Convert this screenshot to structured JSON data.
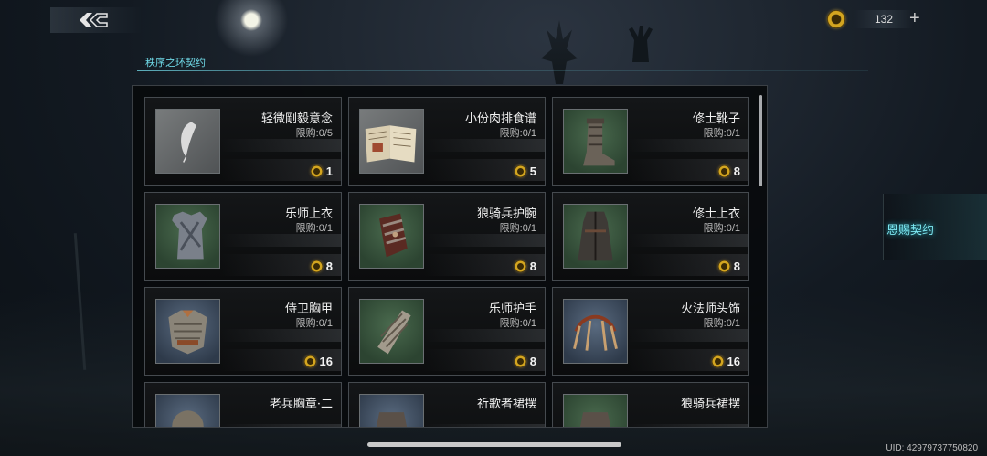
{
  "header": {
    "currency_amount": "132",
    "plus_label": "+"
  },
  "tab": {
    "title": "秩序之环契约"
  },
  "side_tab": {
    "label": "恩赐契约"
  },
  "uid": "UID: 42979737750820",
  "items": [
    {
      "name": "轻微剛毅意念",
      "limit": "限购:0/5",
      "price": "1",
      "icon": "feather-wisp-icon",
      "bg": "gray"
    },
    {
      "name": "小份肉排食谱",
      "limit": "限购:0/1",
      "price": "5",
      "icon": "recipe-book-icon",
      "bg": "gray"
    },
    {
      "name": "修士靴子",
      "limit": "限购:0/1",
      "price": "8",
      "icon": "boots-icon",
      "bg": "green"
    },
    {
      "name": "乐师上衣",
      "limit": "限购:0/1",
      "price": "8",
      "icon": "tunic-icon",
      "bg": "green"
    },
    {
      "name": "狼骑兵护腕",
      "limit": "限购:0/1",
      "price": "8",
      "icon": "bracer-icon",
      "bg": "green"
    },
    {
      "name": "修士上衣",
      "limit": "限购:0/1",
      "price": "8",
      "icon": "robe-icon",
      "bg": "green"
    },
    {
      "name": "侍卫胸甲",
      "limit": "限购:0/1",
      "price": "16",
      "icon": "chest-armor-icon",
      "bg": "blue"
    },
    {
      "name": "乐师护手",
      "limit": "限购:0/1",
      "price": "8",
      "icon": "gauntlet-icon",
      "bg": "green"
    },
    {
      "name": "火法师头饰",
      "limit": "限购:0/1",
      "price": "16",
      "icon": "headdress-icon",
      "bg": "blue"
    },
    {
      "name": "老兵胸章·二",
      "limit": "",
      "price": "",
      "icon": "badge-icon",
      "bg": "blue"
    },
    {
      "name": "祈歌者裙摆",
      "limit": "",
      "price": "",
      "icon": "skirt-icon",
      "bg": "blue"
    },
    {
      "name": "狼骑兵裙摆",
      "limit": "",
      "price": "",
      "icon": "skirt-icon",
      "bg": "green"
    }
  ]
}
